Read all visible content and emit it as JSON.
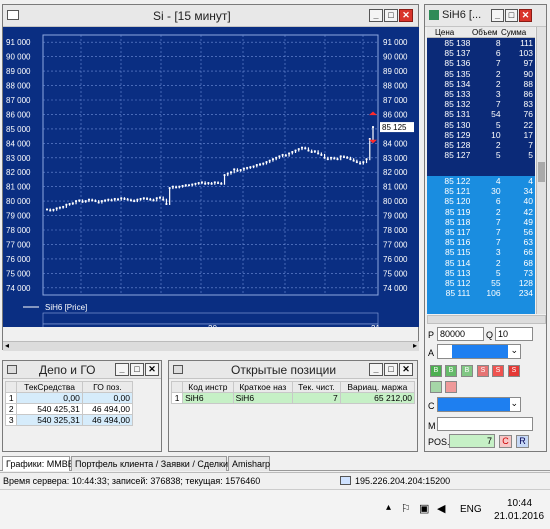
{
  "chart_window": {
    "title": "Si - [15 минут]",
    "series_label": "SiH6 [Price]",
    "price_marker": "85 125",
    "y_ticks": [
      "91 000",
      "90 000",
      "89 000",
      "88 000",
      "87 000",
      "86 000",
      "85 000",
      "84 000",
      "83 000",
      "82 000",
      "81 000",
      "80 000",
      "79 000",
      "78 000",
      "77 000",
      "76 000",
      "75 000",
      "74 000"
    ],
    "x_hours": [
      "16h",
      "19h",
      "22h",
      "11h",
      "14h",
      "17h",
      "20h",
      "23h"
    ],
    "x_dates": [
      "20",
      "21"
    ]
  },
  "chart_data": {
    "type": "line",
    "title": "Si - [15 минут]",
    "xlabel": "",
    "ylabel": "",
    "ylim": [
      73500,
      91500
    ],
    "series": [
      {
        "name": "SiH6 [Price]",
        "values": [
          79420,
          79350,
          79400,
          79500,
          79550,
          79600,
          79750,
          79800,
          79850,
          80000,
          80050,
          79950,
          80000,
          80100,
          80050,
          80000,
          79900,
          80000,
          80050,
          80100,
          80050,
          80150,
          80100,
          80200,
          80150,
          80100,
          80050,
          80000,
          80100,
          80150,
          80200,
          80150,
          80100,
          80050,
          80200,
          80250,
          80100,
          79800,
          80900,
          81000,
          80950,
          81000,
          81050,
          81100,
          81100,
          81150,
          81200,
          81250,
          81300,
          81200,
          81250,
          81200,
          81300,
          81250,
          81200,
          81800,
          81900,
          82000,
          82200,
          82100,
          82150,
          82250,
          82300,
          82350,
          82400,
          82500,
          82550,
          82600,
          82700,
          82800,
          82900,
          83000,
          83100,
          83200,
          83150,
          83300,
          83400,
          83500,
          83600,
          83700,
          83650,
          83500,
          83400,
          83450,
          83300,
          83200,
          83000,
          82900,
          83000,
          82950,
          82900,
          83100,
          83050,
          83000,
          82900,
          82800,
          82700,
          82600,
          82700,
          82900,
          84300,
          85125
        ]
      }
    ]
  },
  "orderbook_window": {
    "title": "SiH6 [...",
    "headers": [
      "Цена",
      "Объем",
      "Сумма"
    ],
    "sell_rows": [
      [
        "85 138",
        "8",
        "111"
      ],
      [
        "85 137",
        "6",
        "103"
      ],
      [
        "85 136",
        "7",
        "97"
      ],
      [
        "85 135",
        "2",
        "90"
      ],
      [
        "85 134",
        "2",
        "88"
      ],
      [
        "85 133",
        "3",
        "86"
      ],
      [
        "85 132",
        "7",
        "83"
      ],
      [
        "85 131",
        "54",
        "76"
      ],
      [
        "85 130",
        "5",
        "22"
      ],
      [
        "85 129",
        "10",
        "17"
      ],
      [
        "85 128",
        "2",
        "7"
      ],
      [
        "85 127",
        "5",
        "5"
      ]
    ],
    "buy_rows": [
      [
        "85 122",
        "4",
        "4"
      ],
      [
        "85 121",
        "30",
        "34"
      ],
      [
        "85 120",
        "6",
        "40"
      ],
      [
        "85 119",
        "2",
        "42"
      ],
      [
        "85 118",
        "7",
        "49"
      ],
      [
        "85 117",
        "7",
        "56"
      ],
      [
        "85 116",
        "7",
        "63"
      ],
      [
        "85 115",
        "3",
        "66"
      ],
      [
        "85 114",
        "2",
        "68"
      ],
      [
        "85 113",
        "5",
        "73"
      ],
      [
        "85 112",
        "55",
        "128"
      ],
      [
        "85 111",
        "106",
        "234"
      ]
    ],
    "price_label": "P",
    "price_value": "80000",
    "qty_label": "Q",
    "qty_value": "10",
    "account_label": "A",
    "client_label": "C",
    "m_label": "M",
    "pos_label": "POS.",
    "pos_value": "7",
    "pos_c": "C",
    "pos_r": "R",
    "buttons": [
      "B",
      "B",
      "B",
      "S",
      "S",
      "S"
    ]
  },
  "depo_window": {
    "title": "Депо и ГО",
    "headers": [
      "",
      "ТекСредства",
      "ГО поз."
    ],
    "rows": [
      [
        "1",
        "0,00",
        "0,00"
      ],
      [
        "2",
        "540 425,31",
        "46 494,00"
      ],
      [
        "3",
        "540 325,31",
        "46 494,00"
      ]
    ]
  },
  "positions_window": {
    "title": "Открытые позиции",
    "headers": [
      "",
      "Код инстр",
      "Краткое наз",
      "Тек. чист.",
      "Вариац. маржа"
    ],
    "rows": [
      [
        "1",
        "SiH6",
        "SiH6",
        "7",
        "65 212,00"
      ]
    ]
  },
  "tabs": [
    "Графики: ММВБ",
    "Портфель клиента / Заявки / Сделки",
    "Amisharp"
  ],
  "status": {
    "server_time": "Время сервера: 10:44:33; записей: 376838; текущая: 1576460",
    "connection": "195.226.204.204:15200"
  },
  "taskbar": {
    "lang": "ENG",
    "time": "10:44",
    "date": "21.01.2016"
  },
  "colors": {
    "chart_bg": "#0a2e82",
    "sell_bg": "#0b2a78",
    "buy_bg": "#1a8de0",
    "accent_green": "#c6f0c6"
  }
}
